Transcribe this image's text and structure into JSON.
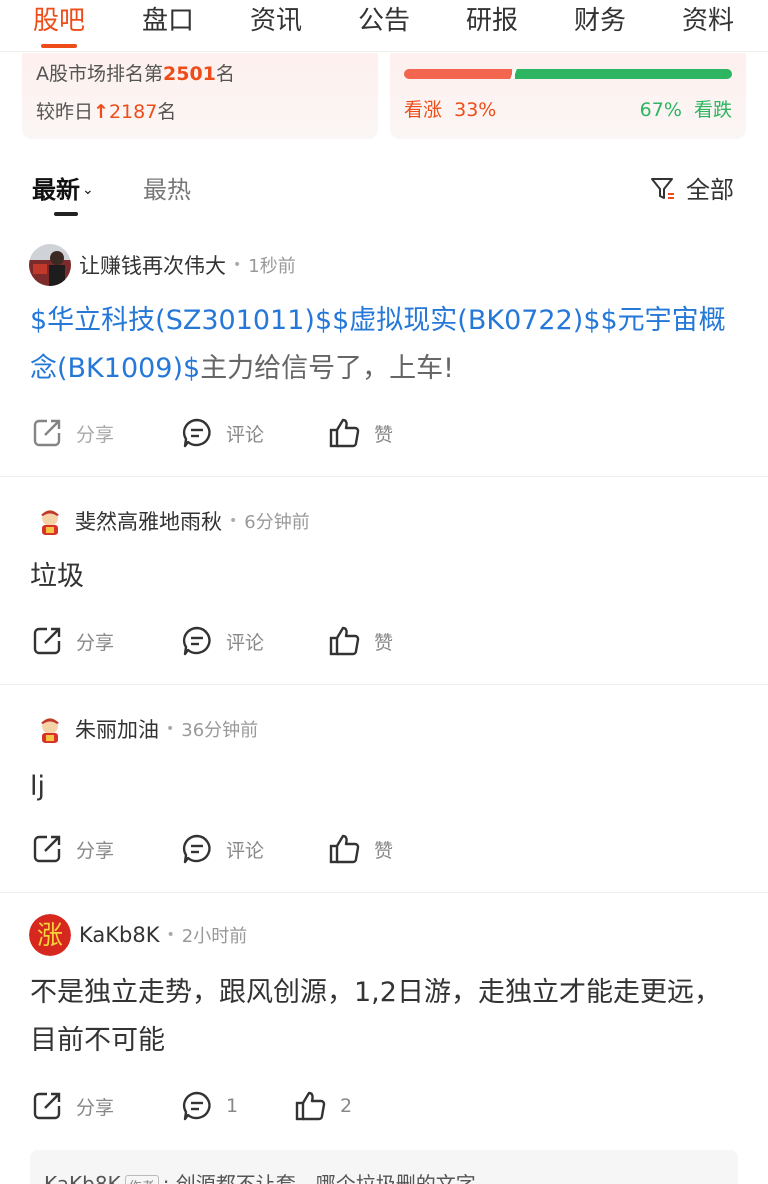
{
  "top_tabs": [
    "股吧",
    "盘口",
    "资讯",
    "公告",
    "研报",
    "财务",
    "资料"
  ],
  "active_tab_index": 0,
  "rank": {
    "prefix": "A股市场排名第",
    "position": "2501",
    "suffix": "名",
    "change_prefix": "较昨日",
    "change_arrow": "↑",
    "change_value": "2187",
    "change_suffix": "名"
  },
  "sentiment": {
    "bull_label": "看涨",
    "bull_percent": "33%",
    "bear_percent": "67%",
    "bear_label": "看跌",
    "bull_fraction": 0.33,
    "bull_color": "#f2664f",
    "bear_color": "#2db561"
  },
  "sort": {
    "latest_label": "最新",
    "hot_label": "最热",
    "filter_label": "全部"
  },
  "actions": {
    "share_label": "分享",
    "comment_label": "评论",
    "like_label": "赞"
  },
  "posts": [
    {
      "author": "让赚钱再次伟大",
      "time": "1秒前",
      "stock_tags": "$华立科技(SZ301011)$$虚拟现实(BK0722)$$元宇宙概念(BK1009)$",
      "text": "主力给信号了，上车!"
    },
    {
      "author": "斐然高雅地雨秋",
      "time": "6分钟前",
      "text": "垃圾"
    },
    {
      "author": "朱丽加油",
      "time": "36分钟前",
      "text": "lj"
    },
    {
      "author": "KaKb8K",
      "avatar_text": "涨",
      "time": "2小时前",
      "text": "不是独立走势，跟风创源，1,2日游，走独立才能走更远，目前不可能",
      "comment_count": "1",
      "like_count": "2"
    }
  ],
  "reply_preview": {
    "author": "KaKb8K",
    "tag": "作者",
    "text": "创源都不让套，哪个垃圾删的文字"
  },
  "colors": {
    "accent": "#ee4d1a",
    "link": "#2578d8",
    "bull": "#ee4d1a",
    "bear": "#2db561"
  }
}
